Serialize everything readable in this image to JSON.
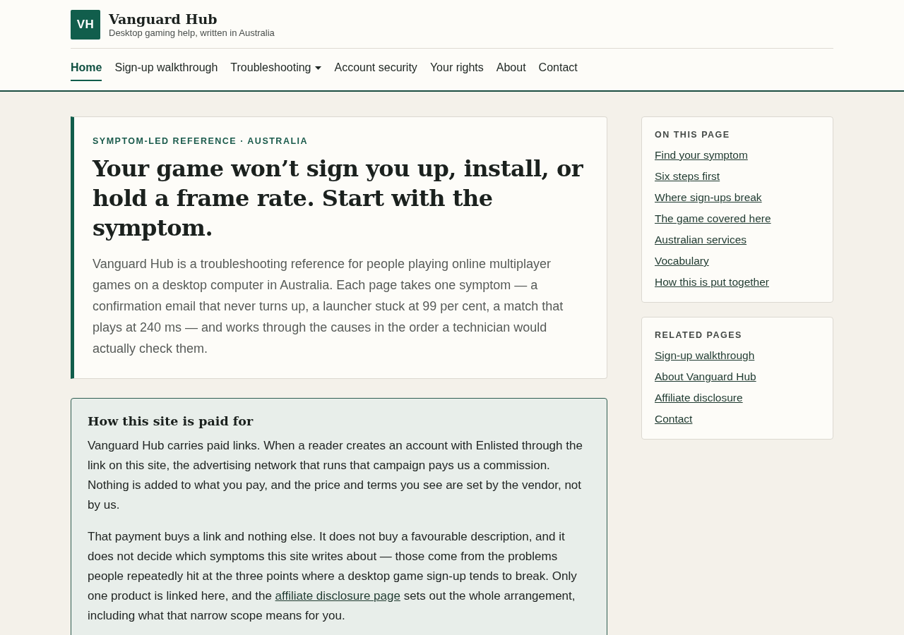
{
  "site": {
    "logo_text": "VH",
    "title": "Vanguard Hub",
    "tagline": "Desktop gaming help, written in Australia"
  },
  "nav": [
    {
      "label": "Home",
      "selected": true,
      "dropdown": false
    },
    {
      "label": "Sign-up walkthrough",
      "selected": false,
      "dropdown": false
    },
    {
      "label": "Troubleshooting",
      "selected": false,
      "dropdown": true
    },
    {
      "label": "Account security",
      "selected": false,
      "dropdown": false
    },
    {
      "label": "Your rights",
      "selected": false,
      "dropdown": false
    },
    {
      "label": "About",
      "selected": false,
      "dropdown": false
    },
    {
      "label": "Contact",
      "selected": false,
      "dropdown": false
    }
  ],
  "hero": {
    "kicker": "SYMPTOM-LED REFERENCE · AUSTRALIA",
    "title": "Your game won’t sign you up, install, or hold a frame rate. Start with the symptom.",
    "lead": "Vanguard Hub is a troubleshooting reference for people playing online multiplayer games on a desktop computer in Australia. Each page takes one symptom — a confirmation email that never turns up, a launcher stuck at 99 per cent, a match that plays at 240 ms — and works through the causes in the order a technician would actually check them."
  },
  "disclosure": {
    "title": "How this site is paid for",
    "paragraphs": [
      [
        {
          "kind": "text",
          "text": "Vanguard Hub carries paid links. When a reader creates an account with Enlisted through the link on this site, the advertising network that runs that campaign pays us a commission. Nothing is added to what you pay, and the price and terms you see are set by the vendor, not by us."
        }
      ],
      [
        {
          "kind": "text",
          "text": "That payment buys a link and nothing else. It does not buy a favourable description, and it does not decide which symptoms this site writes about — those come from the problems people repeatedly hit at the three points where a desktop game sign-up tends to break. Only one product is linked here, and the "
        },
        {
          "kind": "link",
          "text": "affiliate disclosure page"
        },
        {
          "kind": "text",
          "text": " sets out the whole arrangement, including what that narrow scope means for you."
        }
      ]
    ]
  },
  "sidebar": [
    {
      "heading": "ON THIS PAGE",
      "links": [
        "Find your symptom",
        "Six steps first",
        "Where sign-ups break",
        "The game covered here",
        "Australian services",
        "Vocabulary",
        "How this is put together"
      ]
    },
    {
      "heading": "RELATED PAGES",
      "links": [
        "Sign-up walkthrough",
        "About Vanguard Hub",
        "Affiliate disclosure",
        "Contact"
      ]
    }
  ]
}
